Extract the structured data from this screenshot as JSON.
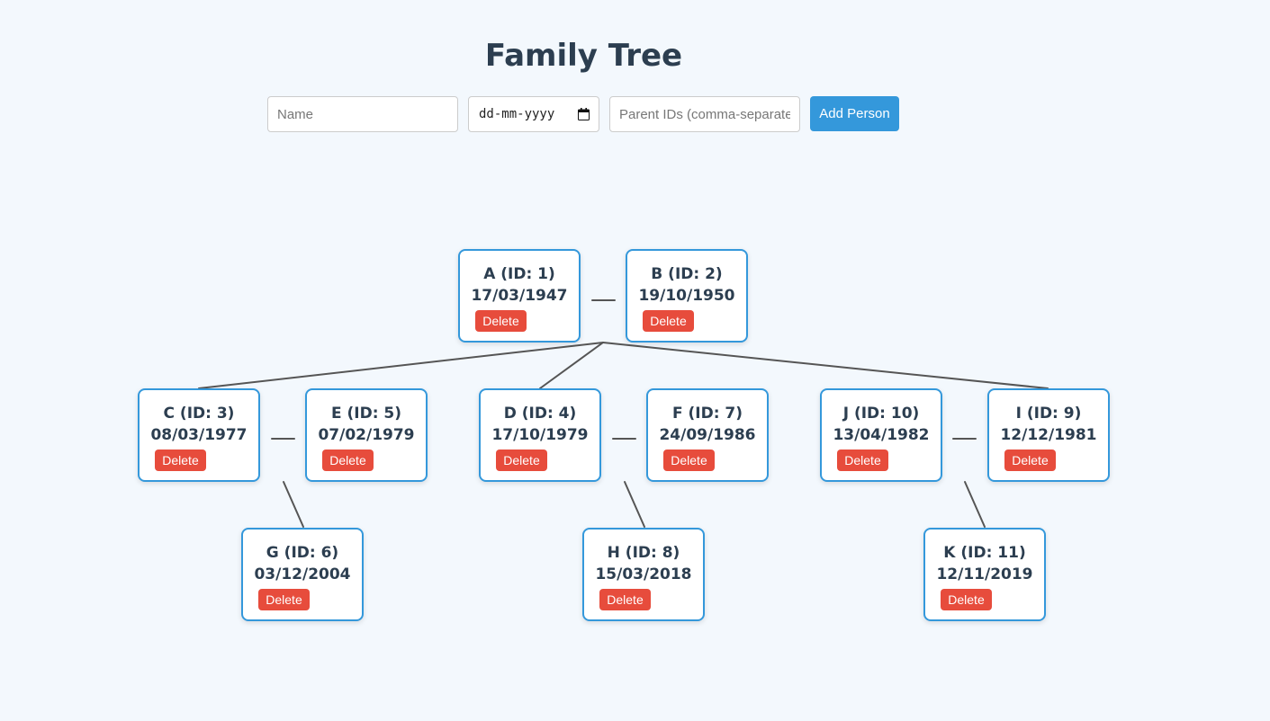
{
  "title": "Family Tree",
  "form": {
    "name_placeholder": "Name",
    "date_placeholder": "dd-mm-yyyy",
    "parents_placeholder": "Parent IDs (comma-separated)",
    "add_label": "Add Person"
  },
  "colors": {
    "accent": "#3498db",
    "danger": "#e74c3c",
    "text": "#2c3e50",
    "background": "#f3f8fd",
    "line": "#555555"
  },
  "people": [
    {
      "label": "A (ID: 1)",
      "date": "17/03/1947",
      "delete": "Delete"
    },
    {
      "label": "B (ID: 2)",
      "date": "19/10/1950",
      "delete": "Delete"
    },
    {
      "label": "C (ID: 3)",
      "date": "08/03/1977",
      "delete": "Delete"
    },
    {
      "label": "E (ID: 5)",
      "date": "07/02/1979",
      "delete": "Delete"
    },
    {
      "label": "D (ID: 4)",
      "date": "17/10/1979",
      "delete": "Delete"
    },
    {
      "label": "F (ID: 7)",
      "date": "24/09/1986",
      "delete": "Delete"
    },
    {
      "label": "J (ID: 10)",
      "date": "13/04/1982",
      "delete": "Delete"
    },
    {
      "label": "I (ID: 9)",
      "date": "12/12/1981",
      "delete": "Delete"
    },
    {
      "label": "G (ID: 6)",
      "date": "03/12/2004",
      "delete": "Delete"
    },
    {
      "label": "H (ID: 8)",
      "date": "15/03/2018",
      "delete": "Delete"
    },
    {
      "label": "K (ID: 11)",
      "date": "12/11/2019",
      "delete": "Delete"
    }
  ]
}
